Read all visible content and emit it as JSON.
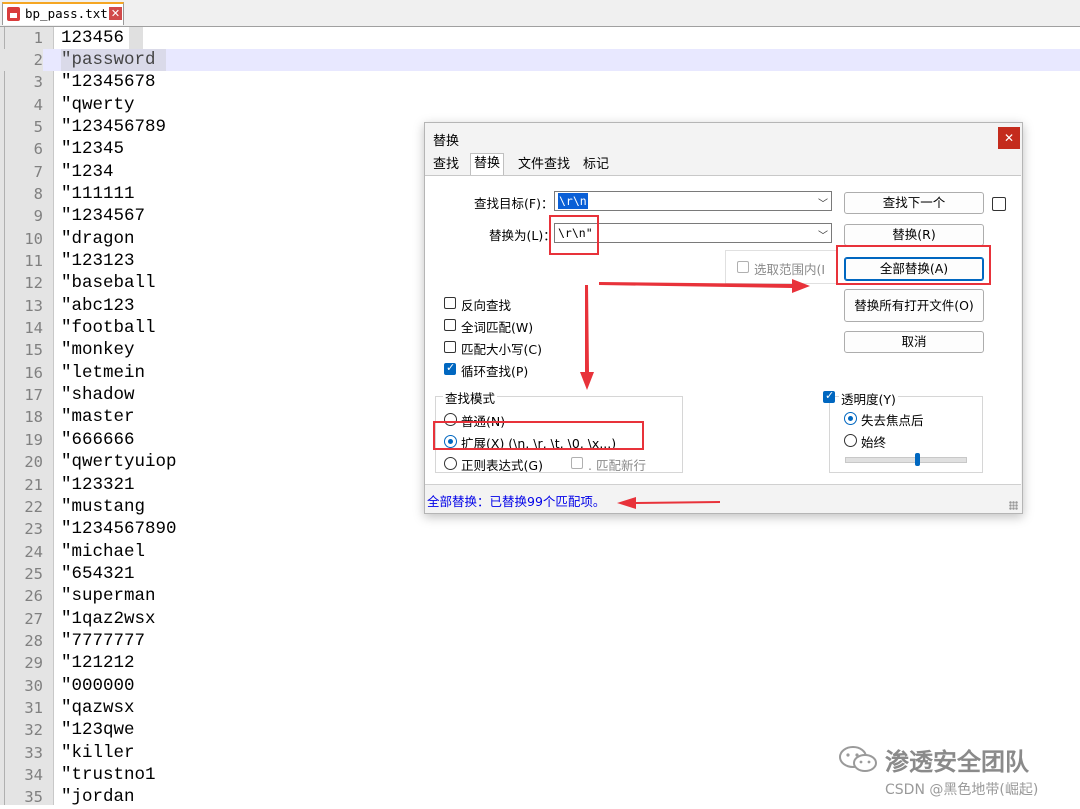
{
  "editor": {
    "tab": {
      "filename": "bp_pass.txt",
      "close_glyph": "✕"
    },
    "lines": [
      {
        "n": "1",
        "text": "123456"
      },
      {
        "n": "2",
        "text": "\"password"
      },
      {
        "n": "3",
        "text": "\"12345678"
      },
      {
        "n": "4",
        "text": "\"qwerty"
      },
      {
        "n": "5",
        "text": "\"123456789"
      },
      {
        "n": "6",
        "text": "\"12345"
      },
      {
        "n": "7",
        "text": "\"1234"
      },
      {
        "n": "8",
        "text": "\"111111"
      },
      {
        "n": "9",
        "text": "\"1234567"
      },
      {
        "n": "10",
        "text": "\"dragon"
      },
      {
        "n": "11",
        "text": "\"123123"
      },
      {
        "n": "12",
        "text": "\"baseball"
      },
      {
        "n": "13",
        "text": "\"abc123"
      },
      {
        "n": "14",
        "text": "\"football"
      },
      {
        "n": "15",
        "text": "\"monkey"
      },
      {
        "n": "16",
        "text": "\"letmein"
      },
      {
        "n": "17",
        "text": "\"shadow"
      },
      {
        "n": "18",
        "text": "\"master"
      },
      {
        "n": "19",
        "text": "\"666666"
      },
      {
        "n": "20",
        "text": "\"qwertyuiop"
      },
      {
        "n": "21",
        "text": "\"123321"
      },
      {
        "n": "22",
        "text": "\"mustang"
      },
      {
        "n": "23",
        "text": "\"1234567890"
      },
      {
        "n": "24",
        "text": "\"michael"
      },
      {
        "n": "25",
        "text": "\"654321"
      },
      {
        "n": "26",
        "text": "\"superman"
      },
      {
        "n": "27",
        "text": "\"1qaz2wsx"
      },
      {
        "n": "28",
        "text": "\"7777777"
      },
      {
        "n": "29",
        "text": "\"121212"
      },
      {
        "n": "30",
        "text": "\"000000"
      },
      {
        "n": "31",
        "text": "\"qazwsx"
      },
      {
        "n": "32",
        "text": "\"123qwe"
      },
      {
        "n": "33",
        "text": "\"killer"
      },
      {
        "n": "34",
        "text": "\"trustno1"
      },
      {
        "n": "35",
        "text": "\"jordan"
      }
    ]
  },
  "dialog": {
    "title": "替换",
    "close_glyph": "✕",
    "tabs": [
      "查找",
      "替换",
      "文件查找",
      "标记"
    ],
    "find_label": "查找目标(F)：",
    "find_value": "\\r\\n",
    "replace_label": "替换为(L)：",
    "replace_value": "\\r\\n\"",
    "in_selection_label": "选取范围内(I",
    "buttons": {
      "find_next": "查找下一个",
      "replace": "替换(R)",
      "replace_all": "全部替换(A)",
      "replace_all_open": "替换所有打开文件(O)",
      "cancel": "取消"
    },
    "options": {
      "backward": "反向查找",
      "whole_word": "全词匹配(W)",
      "match_case": "匹配大小写(C)",
      "wrap_around": "循环查找(P)"
    },
    "search_mode": {
      "title": "查找模式",
      "normal": "普通(N)",
      "extended": "扩展(X) (\\n, \\r, \\t, \\0, \\x...)",
      "regex": "正则表达式(G)",
      "dot_newline": ". 匹配新行"
    },
    "transparency": {
      "label": "透明度(Y)",
      "on_lose_focus": "失去焦点后",
      "always": "始终",
      "level": 0.6
    },
    "status": "全部替换：已替换99个匹配项。"
  },
  "watermark": {
    "title": "渗透安全团队",
    "subtitle": "CSDN @黑色地带(崛起)"
  },
  "colors": {
    "annotation": "#e8323a",
    "status_text": "#0000e8",
    "accent": "#0067c0"
  }
}
